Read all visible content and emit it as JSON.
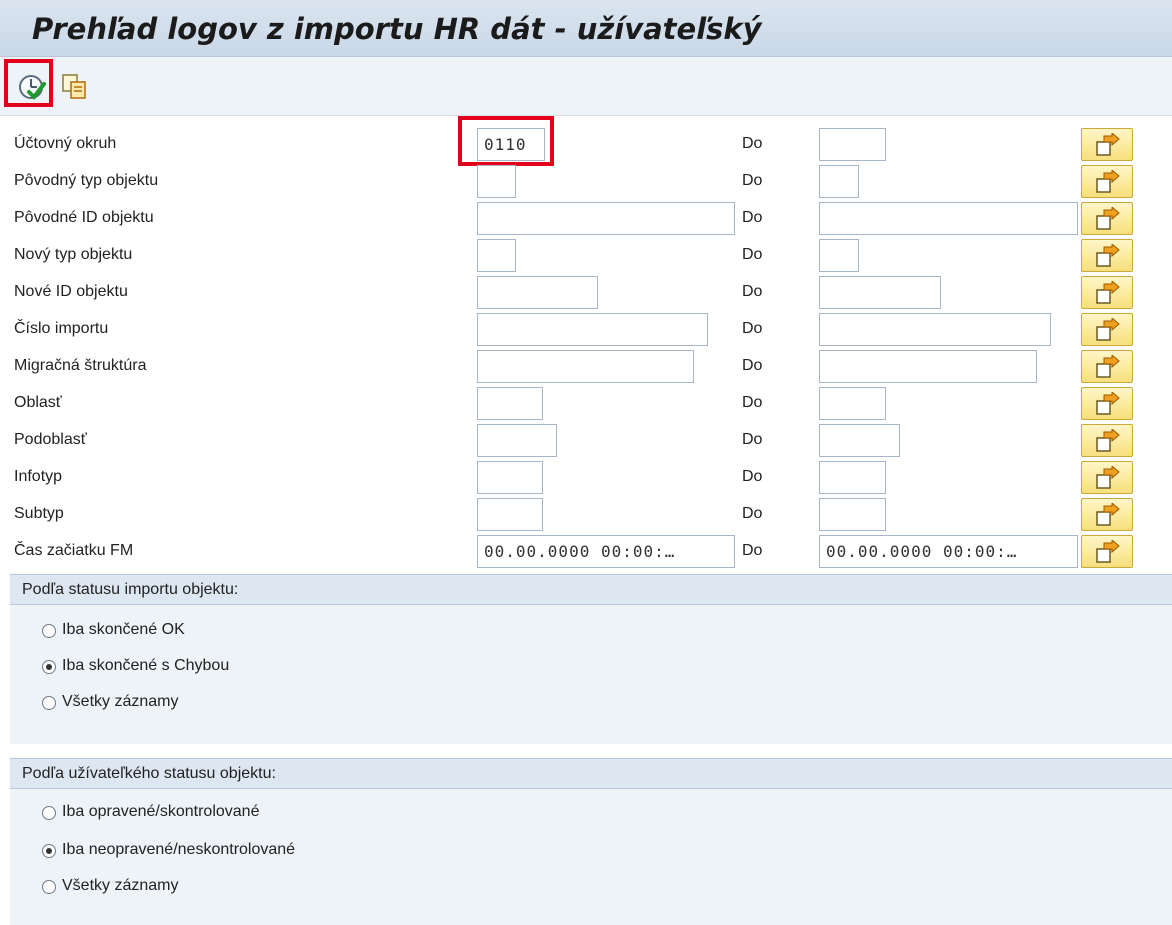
{
  "window": {
    "title": "Prehľad logov z importu HR dát - užívateľský"
  },
  "toolbar": {
    "execute_icon": "execute-icon",
    "copy_icon": "copy-selection-icon"
  },
  "labels": {
    "to": "Do"
  },
  "fields": [
    {
      "label": "Účtovný okruh",
      "from_value": "0110",
      "to_value": ""
    },
    {
      "label": "Pôvodný typ objektu",
      "from_value": "",
      "to_value": ""
    },
    {
      "label": "Pôvodné ID objektu",
      "from_value": "",
      "to_value": ""
    },
    {
      "label": "Nový typ objektu",
      "from_value": "",
      "to_value": ""
    },
    {
      "label": "Nové ID objektu",
      "from_value": "",
      "to_value": ""
    },
    {
      "label": "Číslo importu",
      "from_value": "",
      "to_value": ""
    },
    {
      "label": "Migračná štruktúra",
      "from_value": "",
      "to_value": ""
    },
    {
      "label": "Oblasť",
      "from_value": "",
      "to_value": ""
    },
    {
      "label": "Podoblasť",
      "from_value": "",
      "to_value": ""
    },
    {
      "label": "Infotyp",
      "from_value": "",
      "to_value": ""
    },
    {
      "label": "Subtyp",
      "from_value": "",
      "to_value": ""
    },
    {
      "label": "Čas začiatku FM",
      "from_value": "00.00.0000 00:00:…",
      "to_value": "00.00.0000 00:00:…"
    }
  ],
  "group_import_status": {
    "title": "Podľa statusu importu objektu:",
    "options": [
      {
        "label": "Iba skončené OK",
        "selected": false
      },
      {
        "label": "Iba skončené s Chybou",
        "selected": true
      },
      {
        "label": "Všetky záznamy",
        "selected": false
      }
    ]
  },
  "group_user_status": {
    "title": "Podľa užívateľkého statusu objektu:",
    "options": [
      {
        "label": "Iba opravené/skontrolované",
        "selected": false
      },
      {
        "label": "Iba neopravené/neskontrolované",
        "selected": true
      },
      {
        "label": "Všetky záznamy",
        "selected": false
      }
    ]
  },
  "colors": {
    "highlight": "#e3001b",
    "title_bg": "#d3dfec",
    "group_bg": "#eef3f8"
  }
}
